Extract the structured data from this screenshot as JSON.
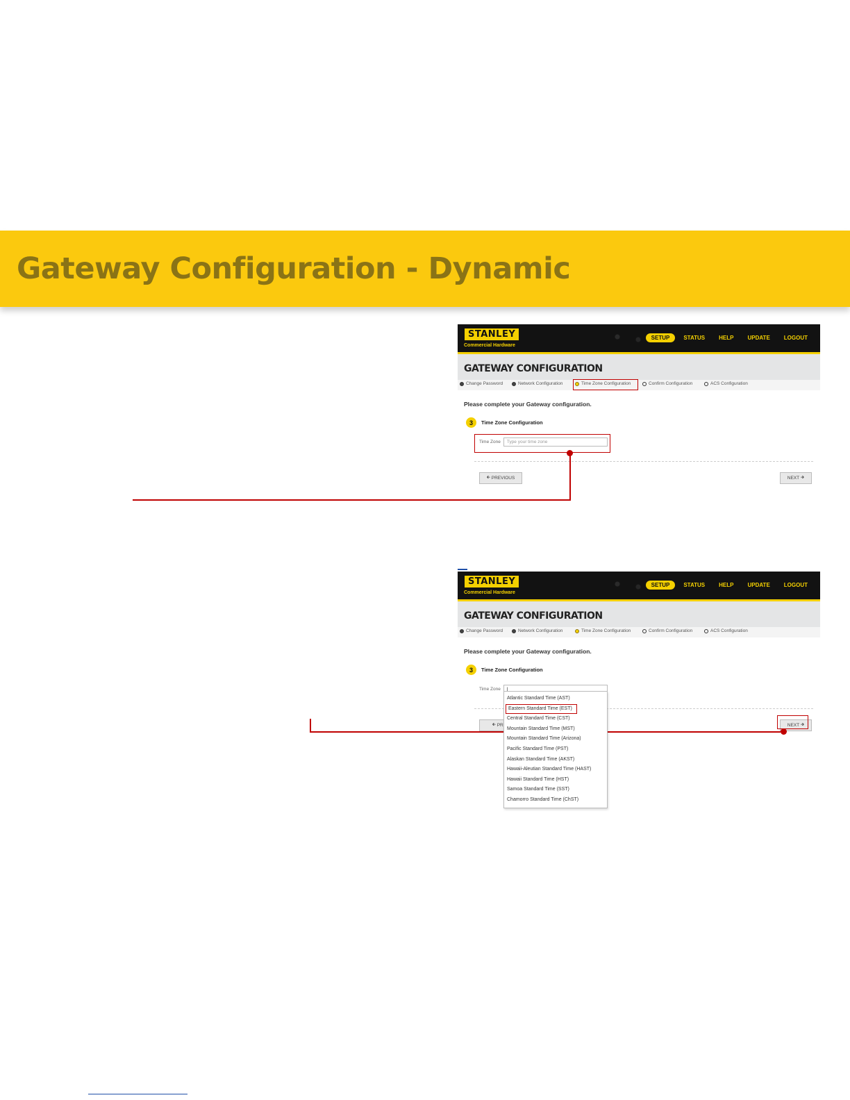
{
  "heading": "Gateway Configuration - Dynamic",
  "screen1": {
    "logo": "STANLEY",
    "logo_sub": "Commercial Hardware",
    "nav": [
      "SETUP",
      "STATUS",
      "HELP",
      "UPDATE",
      "LOGOUT"
    ],
    "active_nav": "SETUP",
    "page_title": "GATEWAY CONFIGURATION",
    "steps": [
      "Change Password",
      "Network Configuration",
      "Time Zone Configuration",
      "Confirm Configuration",
      "ACS Configuration"
    ],
    "intro": "Please complete your Gateway configuration.",
    "section_number": "3",
    "section_title": "Time Zone Configuration",
    "tz_label": "Time Zone",
    "tz_placeholder": "Type your time zone",
    "prev_label": "PREVIOUS",
    "next_label": "NEXT"
  },
  "screen2": {
    "logo": "STANLEY",
    "logo_sub": "Commercial Hardware",
    "nav": [
      "SETUP",
      "STATUS",
      "HELP",
      "UPDATE",
      "LOGOUT"
    ],
    "page_title": "GATEWAY CONFIGURATION",
    "steps": [
      "Change Password",
      "Network Configuration",
      "Time Zone Configuration",
      "Confirm Configuration",
      "ACS Configuration"
    ],
    "intro": "Please complete your Gateway configuration.",
    "section_number": "3",
    "section_title": "Time Zone Configuration",
    "tz_label": "Time Zone",
    "tz_value": "|",
    "prev_label": "PREV",
    "next_label": "NEXT",
    "options": [
      "Atlantic Standard Time (AST)",
      "Eastern Standard Time (EST)",
      "Central Standard Time (CST)",
      "Mountain Standard Time (MST)",
      "Mountain Standard Time (Arizona)",
      "Pacific Standard Time (PST)",
      "Alaskan Standard Time (AKST)",
      "Hawaii-Aleutian Standard Time (HAST)",
      "Hawaii Standard Time (HST)",
      "Samoa Standard Time (SST)",
      "Chamorro Standard Time (ChST)"
    ],
    "highlighted_option": "Eastern Standard Time (EST)"
  },
  "colors": {
    "brand_yellow": "#f4d000",
    "banner": "#fbc90e",
    "callout": "#c00000"
  }
}
